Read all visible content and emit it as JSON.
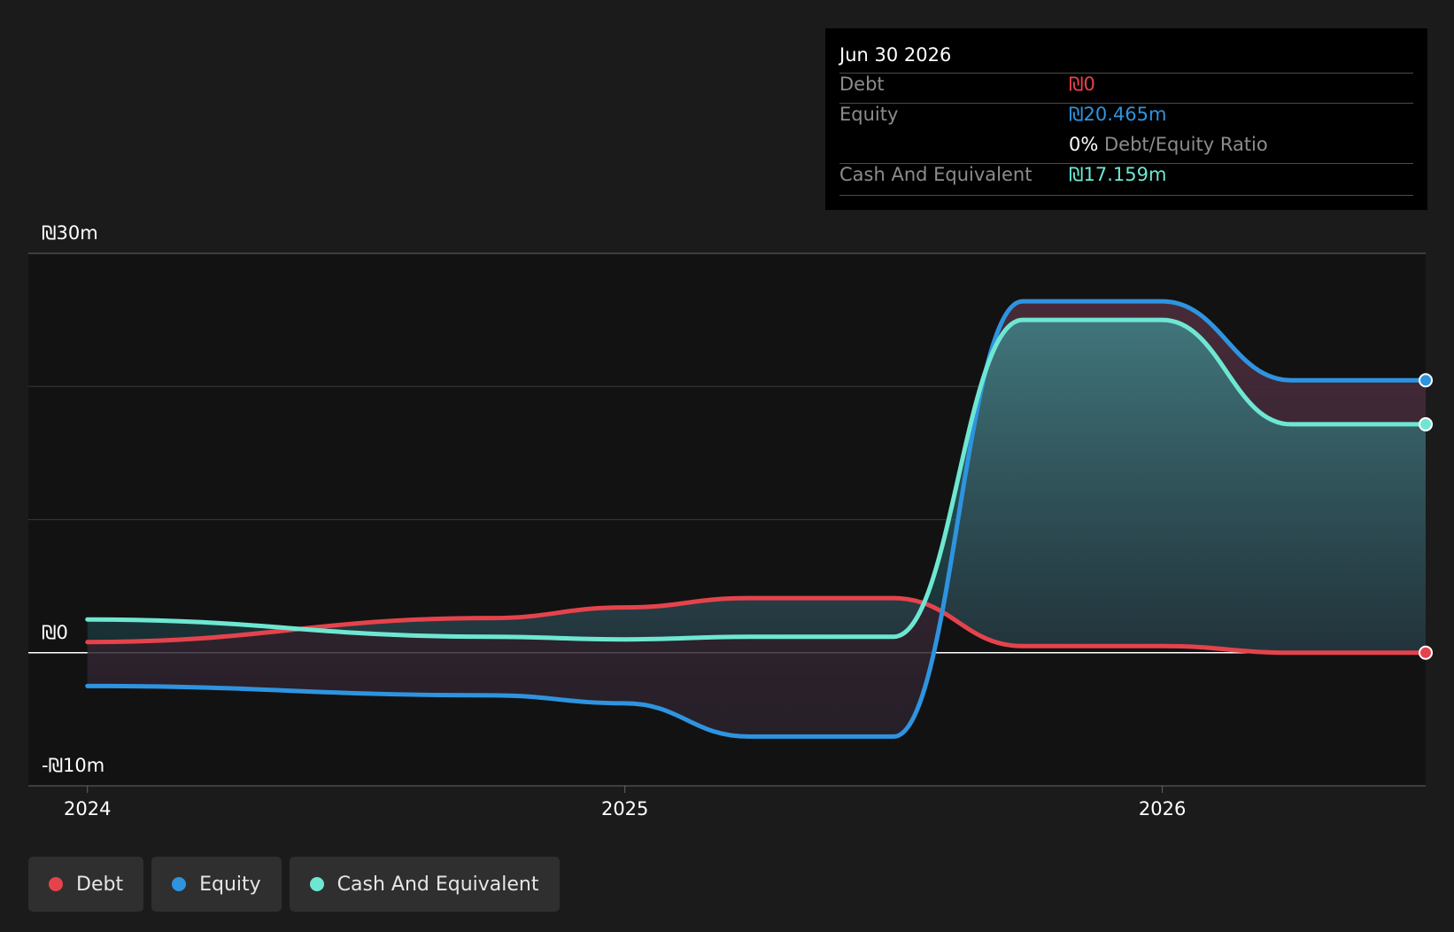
{
  "tooltip": {
    "date": "Jun 30 2026",
    "debt_label": "Debt",
    "debt_value": "₪0",
    "equity_label": "Equity",
    "equity_value": "₪20.465m",
    "ratio_pct": "0%",
    "ratio_label": "Debt/Equity Ratio",
    "cash_label": "Cash And Equivalent",
    "cash_value": "₪17.159m"
  },
  "legend": [
    {
      "label": "Debt",
      "color": "#e5434c"
    },
    {
      "label": "Equity",
      "color": "#2e94e0"
    },
    {
      "label": "Cash And Equivalent",
      "color": "#6ee7d2"
    }
  ],
  "chart_data": {
    "type": "area",
    "currency": "₪",
    "y_ticks": [
      {
        "value": 30,
        "label": "₪30m"
      },
      {
        "value": 0,
        "label": "₪0"
      },
      {
        "value": -10,
        "label": "-₪10m"
      }
    ],
    "x_ticks": [
      {
        "value": 2024.0,
        "label": "2024"
      },
      {
        "value": 2025.0,
        "label": "2025"
      },
      {
        "value": 2026.0,
        "label": "2026"
      }
    ],
    "ylim": [
      -10,
      30
    ],
    "xlim": [
      2023.89,
      2026.49
    ],
    "grid": true,
    "legend_position": "bottom-left",
    "series": [
      {
        "name": "Debt",
        "color": "#e5434c",
        "x": [
          2024.0,
          2024.75,
          2025.0,
          2025.23,
          2025.5,
          2025.74,
          2026.0,
          2026.24,
          2026.49
        ],
        "y": [
          0.8,
          2.6,
          3.4,
          4.1,
          4.1,
          0.5,
          0.5,
          0.0,
          0.0
        ]
      },
      {
        "name": "Equity",
        "color": "#2e94e0",
        "x": [
          2024.0,
          2024.75,
          2025.0,
          2025.23,
          2025.5,
          2025.74,
          2026.0,
          2026.24,
          2026.49
        ],
        "y": [
          -2.5,
          -3.2,
          -3.8,
          -6.3,
          -6.3,
          26.4,
          26.4,
          20.465,
          20.465
        ]
      },
      {
        "name": "Cash And Equivalent",
        "color": "#6ee7d2",
        "x": [
          2024.0,
          2024.75,
          2025.0,
          2025.23,
          2025.5,
          2025.74,
          2026.0,
          2026.24,
          2026.49
        ],
        "y": [
          2.5,
          1.2,
          1.0,
          1.2,
          1.2,
          25.0,
          25.0,
          17.159,
          17.159
        ]
      }
    ]
  }
}
